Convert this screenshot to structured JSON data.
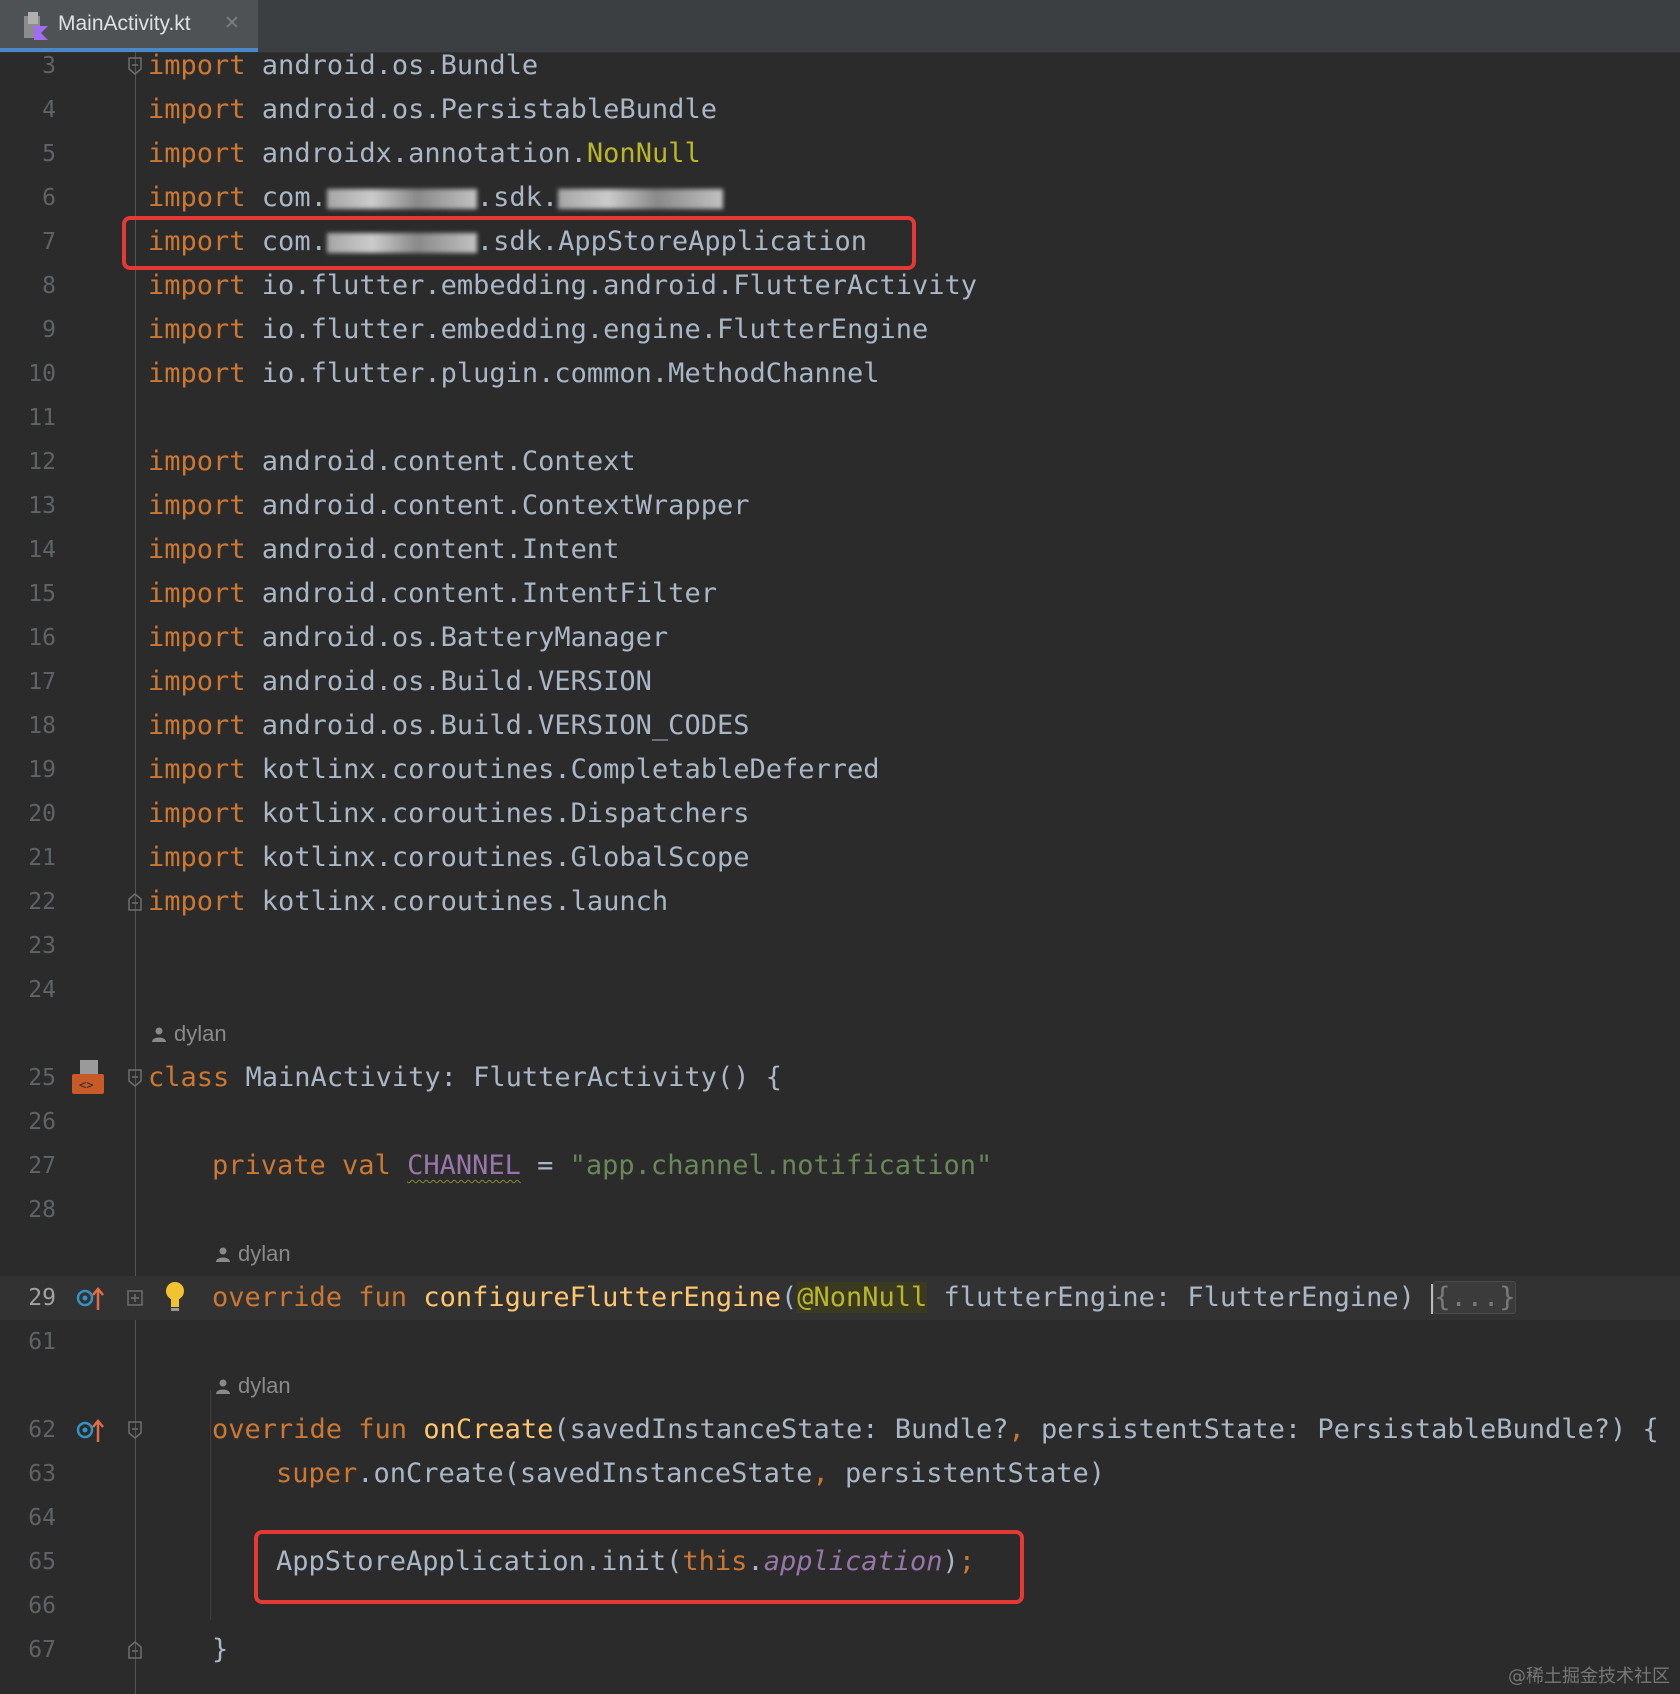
{
  "tab": {
    "label": "MainActivity.kt",
    "close": "✕"
  },
  "lines": [
    {
      "n": "3",
      "kw": "import",
      "rest": " android.os.Bundle"
    },
    {
      "n": "4",
      "kw": "import",
      "rest": " android.os.PersistableBundle"
    },
    {
      "n": "5",
      "kw": "import",
      "rest": " androidx.annotation.",
      "ann": "NonNull"
    },
    {
      "n": "6",
      "kw": "import",
      "a": " com.",
      "b": ".sdk."
    },
    {
      "n": "7",
      "kw": "import",
      "a": " com.",
      "b": ".sdk.AppStoreApplication"
    },
    {
      "n": "8",
      "kw": "import",
      "rest": " io.flutter.embedding.android.FlutterActivity"
    },
    {
      "n": "9",
      "kw": "import",
      "rest": " io.flutter.embedding.engine.FlutterEngine"
    },
    {
      "n": "10",
      "kw": "import",
      "rest": " io.flutter.plugin.common.MethodChannel"
    },
    {
      "n": "11"
    },
    {
      "n": "12",
      "kw": "import",
      "rest": " android.content.Context"
    },
    {
      "n": "13",
      "kw": "import",
      "rest": " android.content.ContextWrapper"
    },
    {
      "n": "14",
      "kw": "import",
      "rest": " android.content.Intent"
    },
    {
      "n": "15",
      "kw": "import",
      "rest": " android.content.IntentFilter"
    },
    {
      "n": "16",
      "kw": "import",
      "rest": " android.os.BatteryManager"
    },
    {
      "n": "17",
      "kw": "import",
      "rest": " android.os.Build.VERSION"
    },
    {
      "n": "18",
      "kw": "import",
      "rest": " android.os.Build.VERSION_CODES"
    },
    {
      "n": "19",
      "kw": "import",
      "rest": " kotlinx.coroutines.CompletableDeferred"
    },
    {
      "n": "20",
      "kw": "import",
      "rest": " kotlinx.coroutines.Dispatchers"
    },
    {
      "n": "21",
      "kw": "import",
      "rest": " kotlinx.coroutines.GlobalScope"
    },
    {
      "n": "22",
      "kw": "import",
      "rest": " kotlinx.coroutines.launch"
    },
    {
      "n": "23"
    },
    {
      "n": "24"
    },
    {
      "n": "25"
    },
    {
      "n": "26"
    },
    {
      "n": "27"
    },
    {
      "n": "28"
    },
    {
      "n": "29"
    },
    {
      "n": "61"
    },
    {
      "n": "62"
    },
    {
      "n": "63"
    },
    {
      "n": "64"
    },
    {
      "n": "65"
    },
    {
      "n": "66"
    },
    {
      "n": "67"
    }
  ],
  "authors": {
    "a1": "dylan",
    "a2": "dylan",
    "a3": "dylan"
  },
  "code": {
    "l25_kw": "class",
    "l25_rest": " MainActivity: FlutterActivity() {",
    "l27_kw": "private val ",
    "l27_const": "CHANNEL",
    "l27_eq": " = ",
    "l27_str": "\"app.channel.notification\"",
    "l29_kw": "override fun ",
    "l29_fn": "configureFlutterEngine",
    "l29_p1": "(",
    "l29_ann": "@NonNull",
    "l29_p2": " flutterEngine: FlutterEngine) ",
    "l29_fold": "{...}",
    "l62_kw": "override fun ",
    "l62_fn": "onCreate",
    "l62_p1": "(savedInstanceState: Bundle?",
    "l62_comma1": ",",
    "l62_p2": " persistentState: PersistableBundle?) {",
    "l63_kw": "super",
    "l63_p1": ".onCreate(savedInstanceState",
    "l63_comma": ",",
    "l63_p2": " persistentState)",
    "l65_p1": "AppStoreApplication.init(",
    "l65_kw": "this",
    "l65_dot": ".",
    "l65_prop": "application",
    "l65_end": ")",
    "l65_semi": ";",
    "l67": "}"
  },
  "watermark": "@稀土掘金技术社区"
}
